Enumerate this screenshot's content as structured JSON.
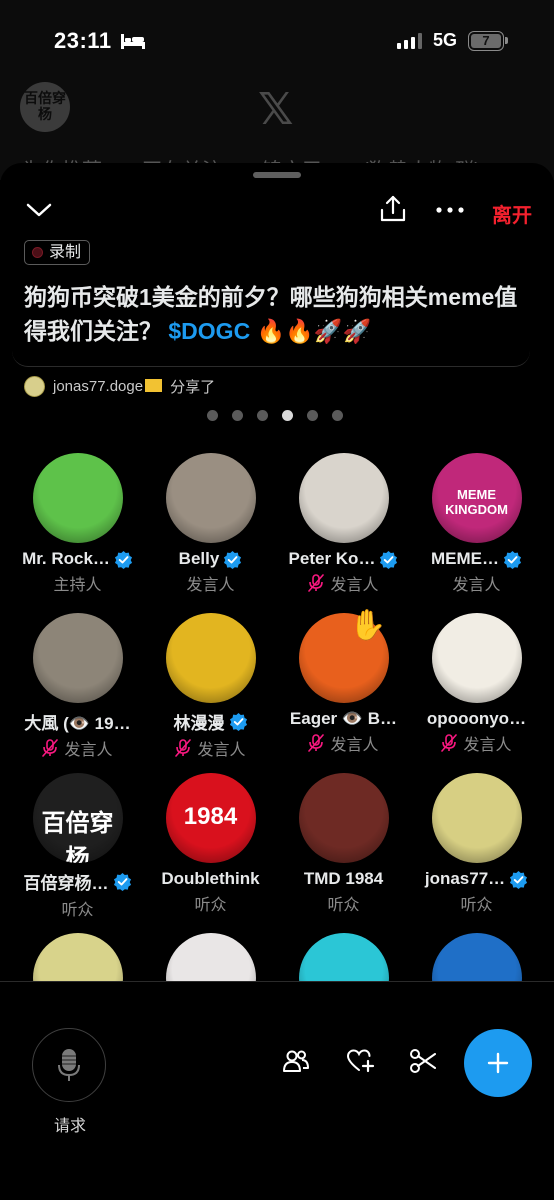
{
  "status_bar": {
    "time": "23:11",
    "network": "5G",
    "battery": "7"
  },
  "background": {
    "avatar_text": "百倍穿杨",
    "tabs": [
      "为你推荐",
      "正在关注",
      "锦衣卫",
      "(狗势人物 群)"
    ]
  },
  "header": {
    "leave_label": "离开"
  },
  "space": {
    "badge": "录制",
    "title_main": "狗狗币突破1美金的前夕？哪些狗狗相关meme值得我们关注？",
    "title_ticker": "$DOGC",
    "title_emoji": "🔥🔥🚀🚀",
    "shared_by": "jonas77.doge",
    "shared_suffix": "分享了",
    "page_count": 6,
    "active_page": 3
  },
  "participants": [
    {
      "name": "Mr. Rock…",
      "role": "主持人",
      "verified": true,
      "muted": false,
      "avatar_color": "#5ec24a"
    },
    {
      "name": "Belly",
      "role": "发言人",
      "verified": true,
      "muted": false,
      "avatar_color": "#9a8f82"
    },
    {
      "name": "Peter Ko…",
      "role": "发言人",
      "verified": true,
      "muted": true,
      "avatar_color": "#d9d4cc"
    },
    {
      "name": "MEME…",
      "role": "发言人",
      "verified": true,
      "muted": false,
      "avatar_color": "#c0287a",
      "avatar_text": "MEME KINGDOM"
    },
    {
      "name": "大風 (👁️ 19…",
      "role": "发言人",
      "verified": false,
      "muted": true,
      "avatar_color": "#8d8578"
    },
    {
      "name": "林漫漫",
      "role": "发言人",
      "verified": true,
      "muted": true,
      "avatar_color": "#e2b520"
    },
    {
      "name": "Eager 👁️ B…",
      "role": "发言人",
      "verified": false,
      "muted": true,
      "avatar_color": "#e8601d",
      "raised_hand": true
    },
    {
      "name": "opooonyo…",
      "role": "发言人",
      "verified": false,
      "muted": true,
      "avatar_color": "#f1ede4"
    },
    {
      "name": "百倍穿杨…",
      "role": "听众",
      "verified": true,
      "muted": false,
      "avatar_color": "#1f1f1f",
      "avatar_text": "百倍穿杨"
    },
    {
      "name": "Doublethink",
      "role": "听众",
      "verified": false,
      "muted": false,
      "avatar_color": "#d9111d",
      "avatar_text": "1984"
    },
    {
      "name": "TMD 1984",
      "role": "听众",
      "verified": false,
      "muted": false,
      "avatar_color": "#6e2a24"
    },
    {
      "name": "jonas77…",
      "role": "听众",
      "verified": true,
      "muted": false,
      "avatar_color": "#d7cf83"
    },
    {
      "name": "",
      "role": "",
      "verified": false,
      "muted": false,
      "avatar_color": "#d8d38b"
    },
    {
      "name": "",
      "role": "",
      "verified": false,
      "muted": false,
      "avatar_color": "#e9e6e6"
    },
    {
      "name": "",
      "role": "",
      "verified": false,
      "muted": false,
      "avatar_color": "#2bc6d6"
    },
    {
      "name": "",
      "role": "",
      "verified": false,
      "muted": false,
      "avatar_color": "#1f6fc7"
    }
  ],
  "bottom_bar": {
    "request_label": "请求"
  },
  "colors": {
    "accent": "#1d9bf0",
    "leave": "#f4212e",
    "muted_icon": "#f91880"
  }
}
